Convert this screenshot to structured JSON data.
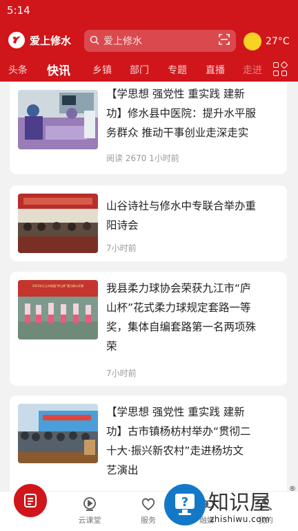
{
  "status_bar": {
    "time": "5:14"
  },
  "header": {
    "logo_text": "爱上修水",
    "search_placeholder": "爱上修水",
    "temperature": "27°C"
  },
  "tabs": [
    {
      "label": "头条"
    },
    {
      "label": "快讯",
      "active": true
    },
    {
      "label": "乡镇"
    },
    {
      "label": "部门"
    },
    {
      "label": "专题"
    },
    {
      "label": "直播"
    },
    {
      "label": "走进"
    }
  ],
  "articles": [
    {
      "title_lines": [
        "【学思想 强党性 重实践 建新",
        "功】修水县中医院：提升水平服",
        "务群众 推动干事创业走深走实"
      ],
      "meta": "阅读 2670  1小时前"
    },
    {
      "title_lines": [
        "山谷诗社与修水中专联合举办重",
        "阳诗会"
      ],
      "meta": "7小时前"
    },
    {
      "title_lines": [
        "我县柔力球协会荣获九江市“庐",
        "山杯”花式柔力球规定套路一等",
        "奖，集体自编套路第一名两项殊",
        "荣"
      ],
      "meta": "7小时前",
      "image_banner": "2022年九江市首届“庐山杯”柔力球公开赛"
    },
    {
      "title_lines": [
        "【学思想 强党性 重实践 建新",
        "功】古市镇杨枋村举办“贯彻二",
        "十大·振兴新农村”走进杨坊文",
        "艺演出"
      ],
      "meta": ""
    }
  ],
  "bottom_nav": [
    {
      "label": "云课堂",
      "icon": "play-icon"
    },
    {
      "label": "服务",
      "icon": "heart-icon"
    },
    {
      "label": "融媒",
      "icon": "media-icon"
    },
    {
      "label": "我的",
      "icon": "user-icon"
    }
  ],
  "watermark": {
    "title": "知识屋",
    "domain": "zhishiwu.com",
    "reg": "®"
  },
  "colors": {
    "brand_red": "#d0161b",
    "sun": "#f9d224",
    "watermark_blue": "#1478c8"
  }
}
